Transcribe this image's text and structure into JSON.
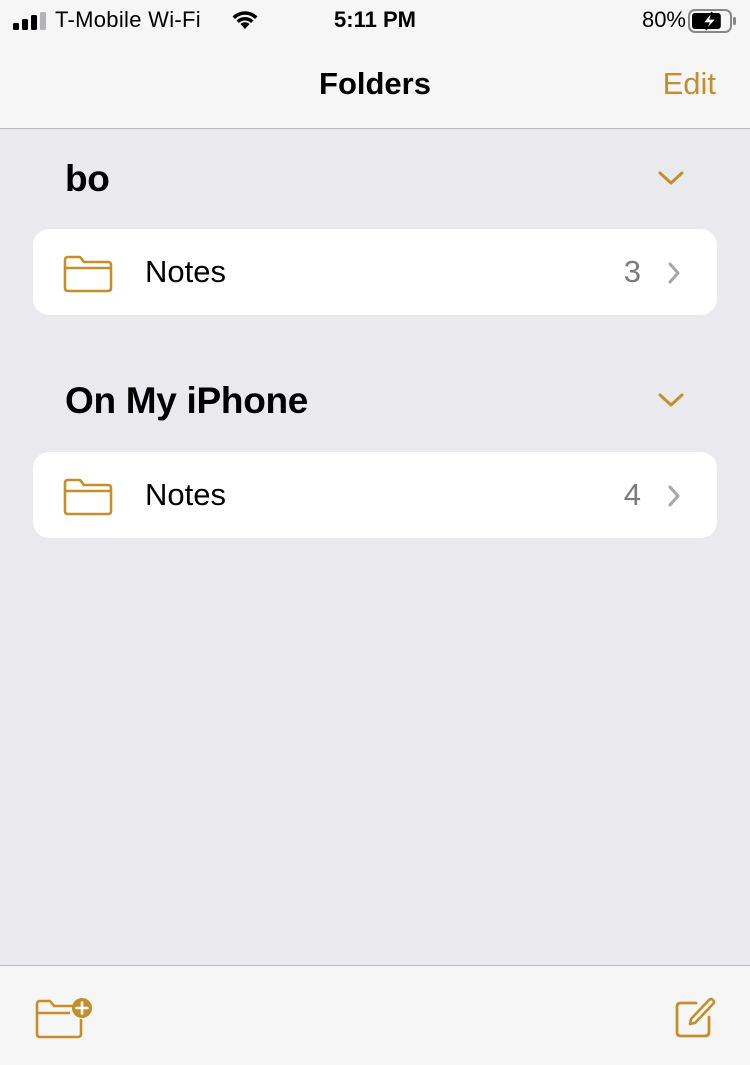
{
  "status_bar": {
    "carrier": "T-Mobile Wi-Fi",
    "time": "5:11 PM",
    "battery_percent": "80%",
    "battery_level": 0.8,
    "signal_icon": "cellular-signal-icon",
    "wifi_icon": "wifi-icon",
    "battery_icon": "battery-charging-icon"
  },
  "nav": {
    "title": "Folders",
    "edit_label": "Edit"
  },
  "sections": [
    {
      "title": "bo",
      "collapse_icon": "chevron-down-icon",
      "folders": [
        {
          "icon": "folder-icon",
          "label": "Notes",
          "count": "3"
        }
      ]
    },
    {
      "title": "On My iPhone",
      "collapse_icon": "chevron-down-icon",
      "folders": [
        {
          "icon": "folder-icon",
          "label": "Notes",
          "count": "4"
        }
      ]
    }
  ],
  "toolbar": {
    "new_folder_icon": "new-folder-icon",
    "compose_icon": "compose-icon"
  },
  "colors": {
    "accent": "#c48f2b",
    "background": "#e9e9ee",
    "bar_background": "#f6f6f7",
    "secondary_text": "#7b7b80"
  }
}
